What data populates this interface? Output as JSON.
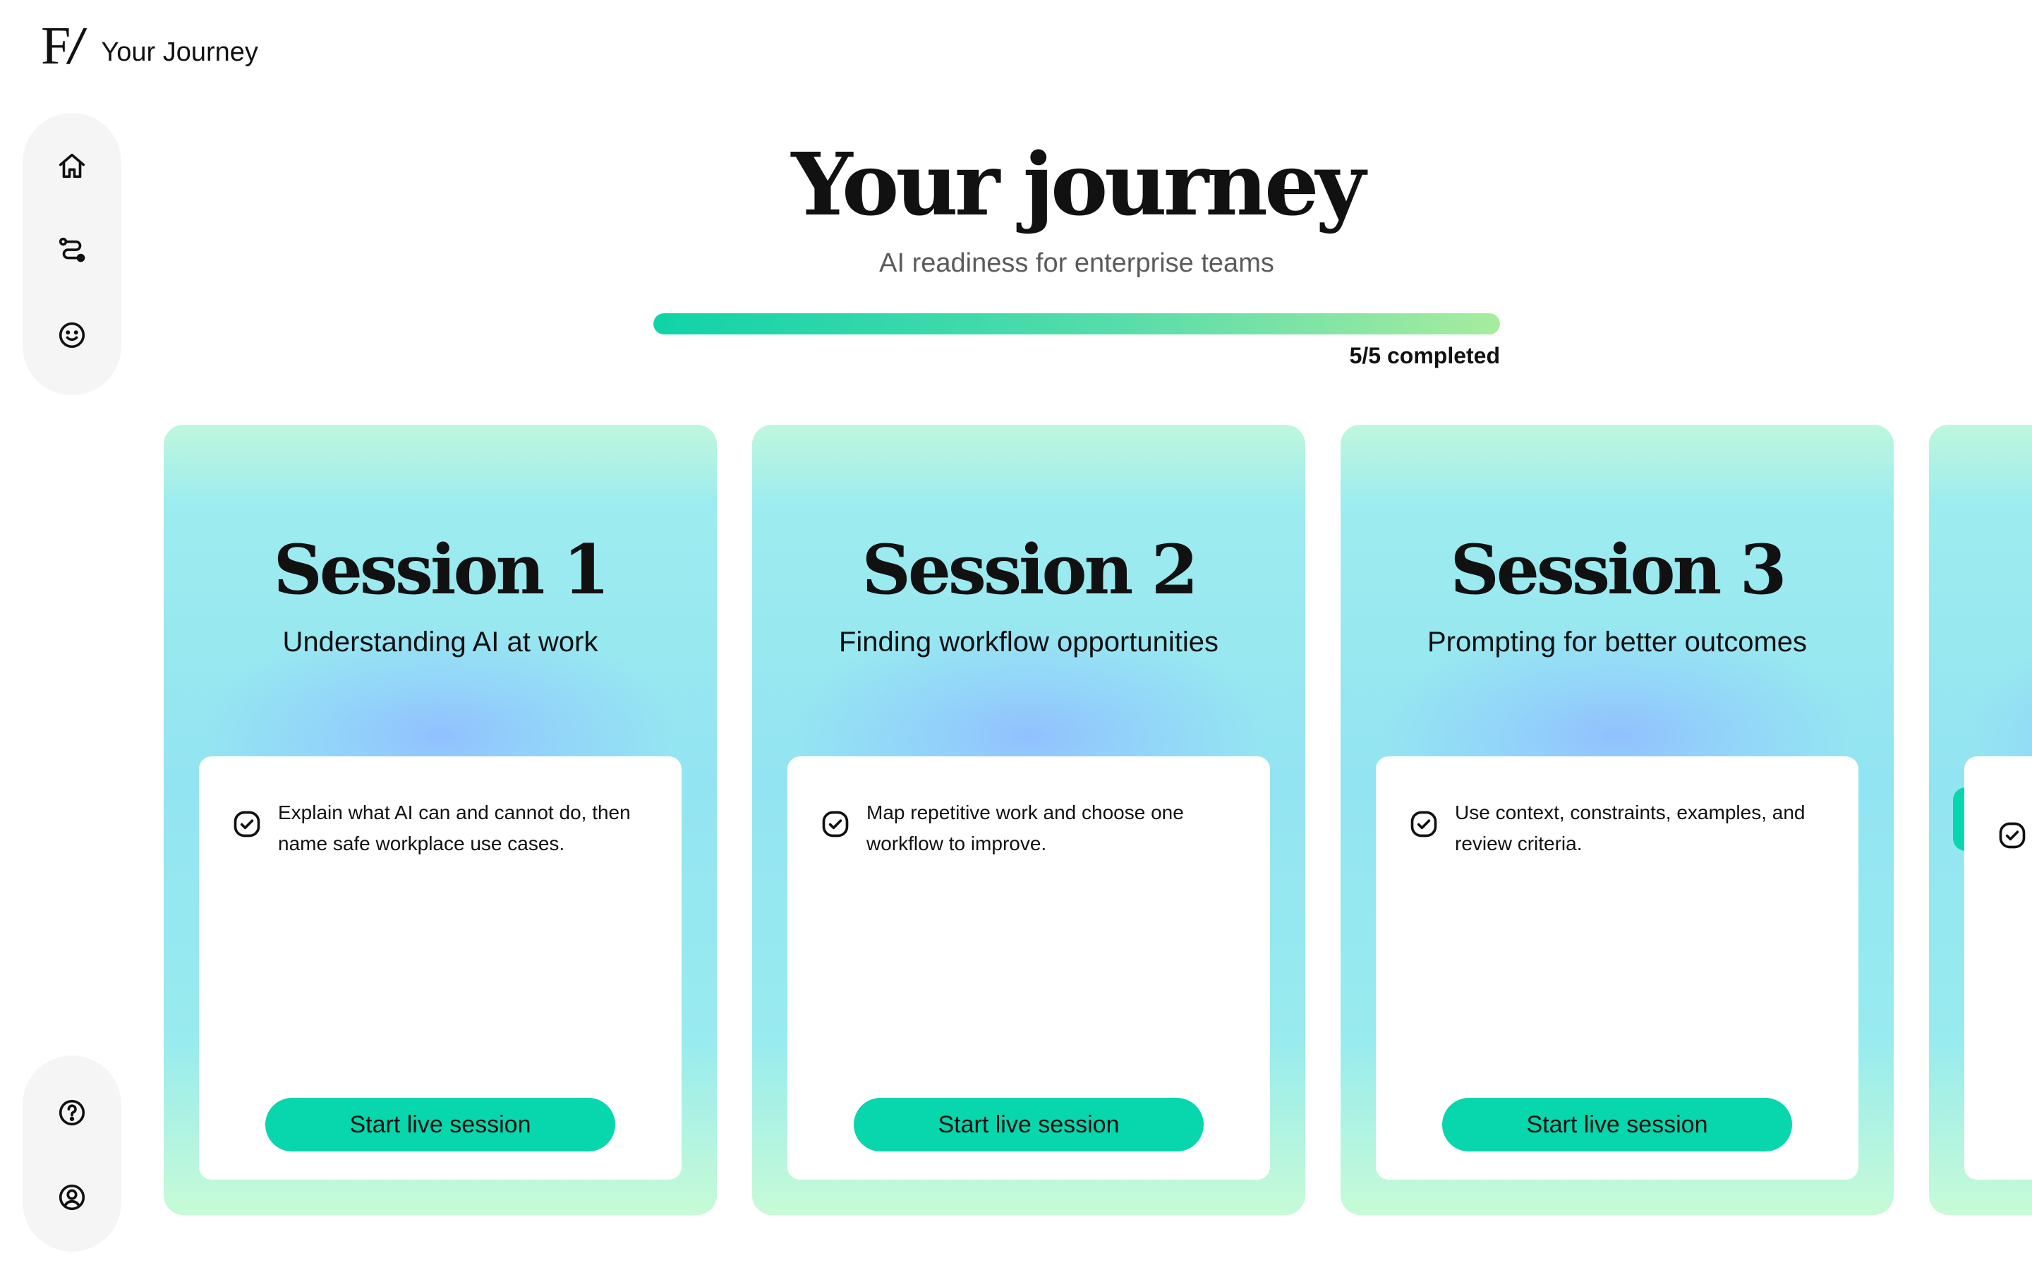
{
  "app": {
    "logo_text": "F/",
    "title": "Your Journey"
  },
  "nav": {
    "top": [
      {
        "icon": "home-icon",
        "label": "Home"
      },
      {
        "icon": "journey-path-icon",
        "label": "Journey"
      },
      {
        "icon": "smiley-icon",
        "label": "Feedback"
      }
    ],
    "bottom": [
      {
        "icon": "help-icon",
        "label": "Help"
      },
      {
        "icon": "profile-icon",
        "label": "Profile"
      }
    ]
  },
  "hero": {
    "title": "Your journey",
    "subtitle": "AI readiness for enterprise teams"
  },
  "progress": {
    "completed": 5,
    "total": 5,
    "label": "5/5 completed",
    "gradient": [
      "#10d3a8",
      "#a7ec9e"
    ]
  },
  "colors": {
    "accent": "#08d6ad",
    "card_teal": "#93e4f2",
    "card_mint": "#c7fbd6",
    "card_blue_glow": "#91beff"
  },
  "sessions": [
    {
      "title": "Session 1",
      "subtitle": "Understanding AI at work",
      "task": "Explain what AI can and cannot do, then name safe workplace use cases.",
      "task_done": true,
      "button": "Start live session"
    },
    {
      "title": "Session 2",
      "subtitle": "Finding workflow opportunities",
      "task": "Map repetitive work and choose one workflow to improve.",
      "task_done": true,
      "button": "Start live session"
    },
    {
      "title": "Session 3",
      "subtitle": "Prompting for better outcomes",
      "task": "Use context, constraints, examples, and review criteria.",
      "task_done": true,
      "button": "Start live session"
    }
  ]
}
